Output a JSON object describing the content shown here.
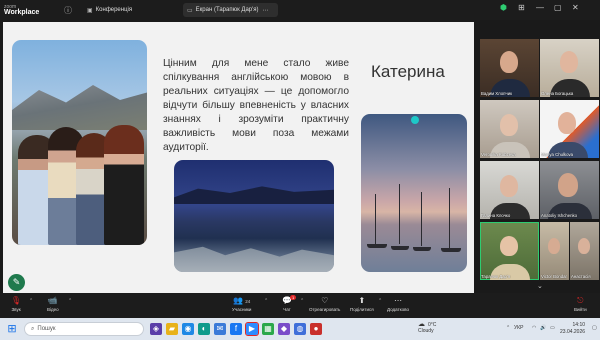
{
  "app": {
    "brand_line1": "zoom",
    "brand_line2": "Workplace"
  },
  "tabs": [
    {
      "label": "Конференція"
    },
    {
      "label": "Екран (Тарапюк Дар'я)"
    }
  ],
  "slide": {
    "paragraph": "Цінним для мене стало живе спілкування англійською мовою в реальних ситуаціях — це допомогло відчути більшу впевненість у власних знаннях і зрозуміти практичну важливість мови поза межами аудиторії.",
    "name": "Катерина"
  },
  "participants": [
    {
      "name": "Вадим Хлопчик"
    },
    {
      "name": "Олена Богацька"
    },
    {
      "name": "Veronika Kobzeva"
    },
    {
      "name": "Mariya Chulkova"
    },
    {
      "name": "Галина Клочко"
    },
    {
      "name": "Anatoliy Ishchenko"
    },
    {
      "name": "Тарапюк Дар'я"
    },
    {
      "name": "Victor Bondar"
    },
    {
      "name": "Анастасія"
    }
  ],
  "toolbar": {
    "audio": "Звук",
    "video": "Відео",
    "participants": "Учасники",
    "participants_count": "24",
    "chat": "Чат",
    "chat_badge": "1",
    "react": "Отреагировать",
    "share": "Поділитися",
    "more": "Додатково",
    "leave": "Вийти"
  },
  "taskbar": {
    "search_placeholder": "Пошук",
    "weather_temp": "0°C",
    "weather_text": "Cloudy",
    "lang": "УКР",
    "time": "14:10",
    "date": "23.04.2026"
  },
  "colors": {
    "slide_bg": "#f2f2f2",
    "accent_green": "#2ecc71",
    "leave_red": "#e02828"
  }
}
